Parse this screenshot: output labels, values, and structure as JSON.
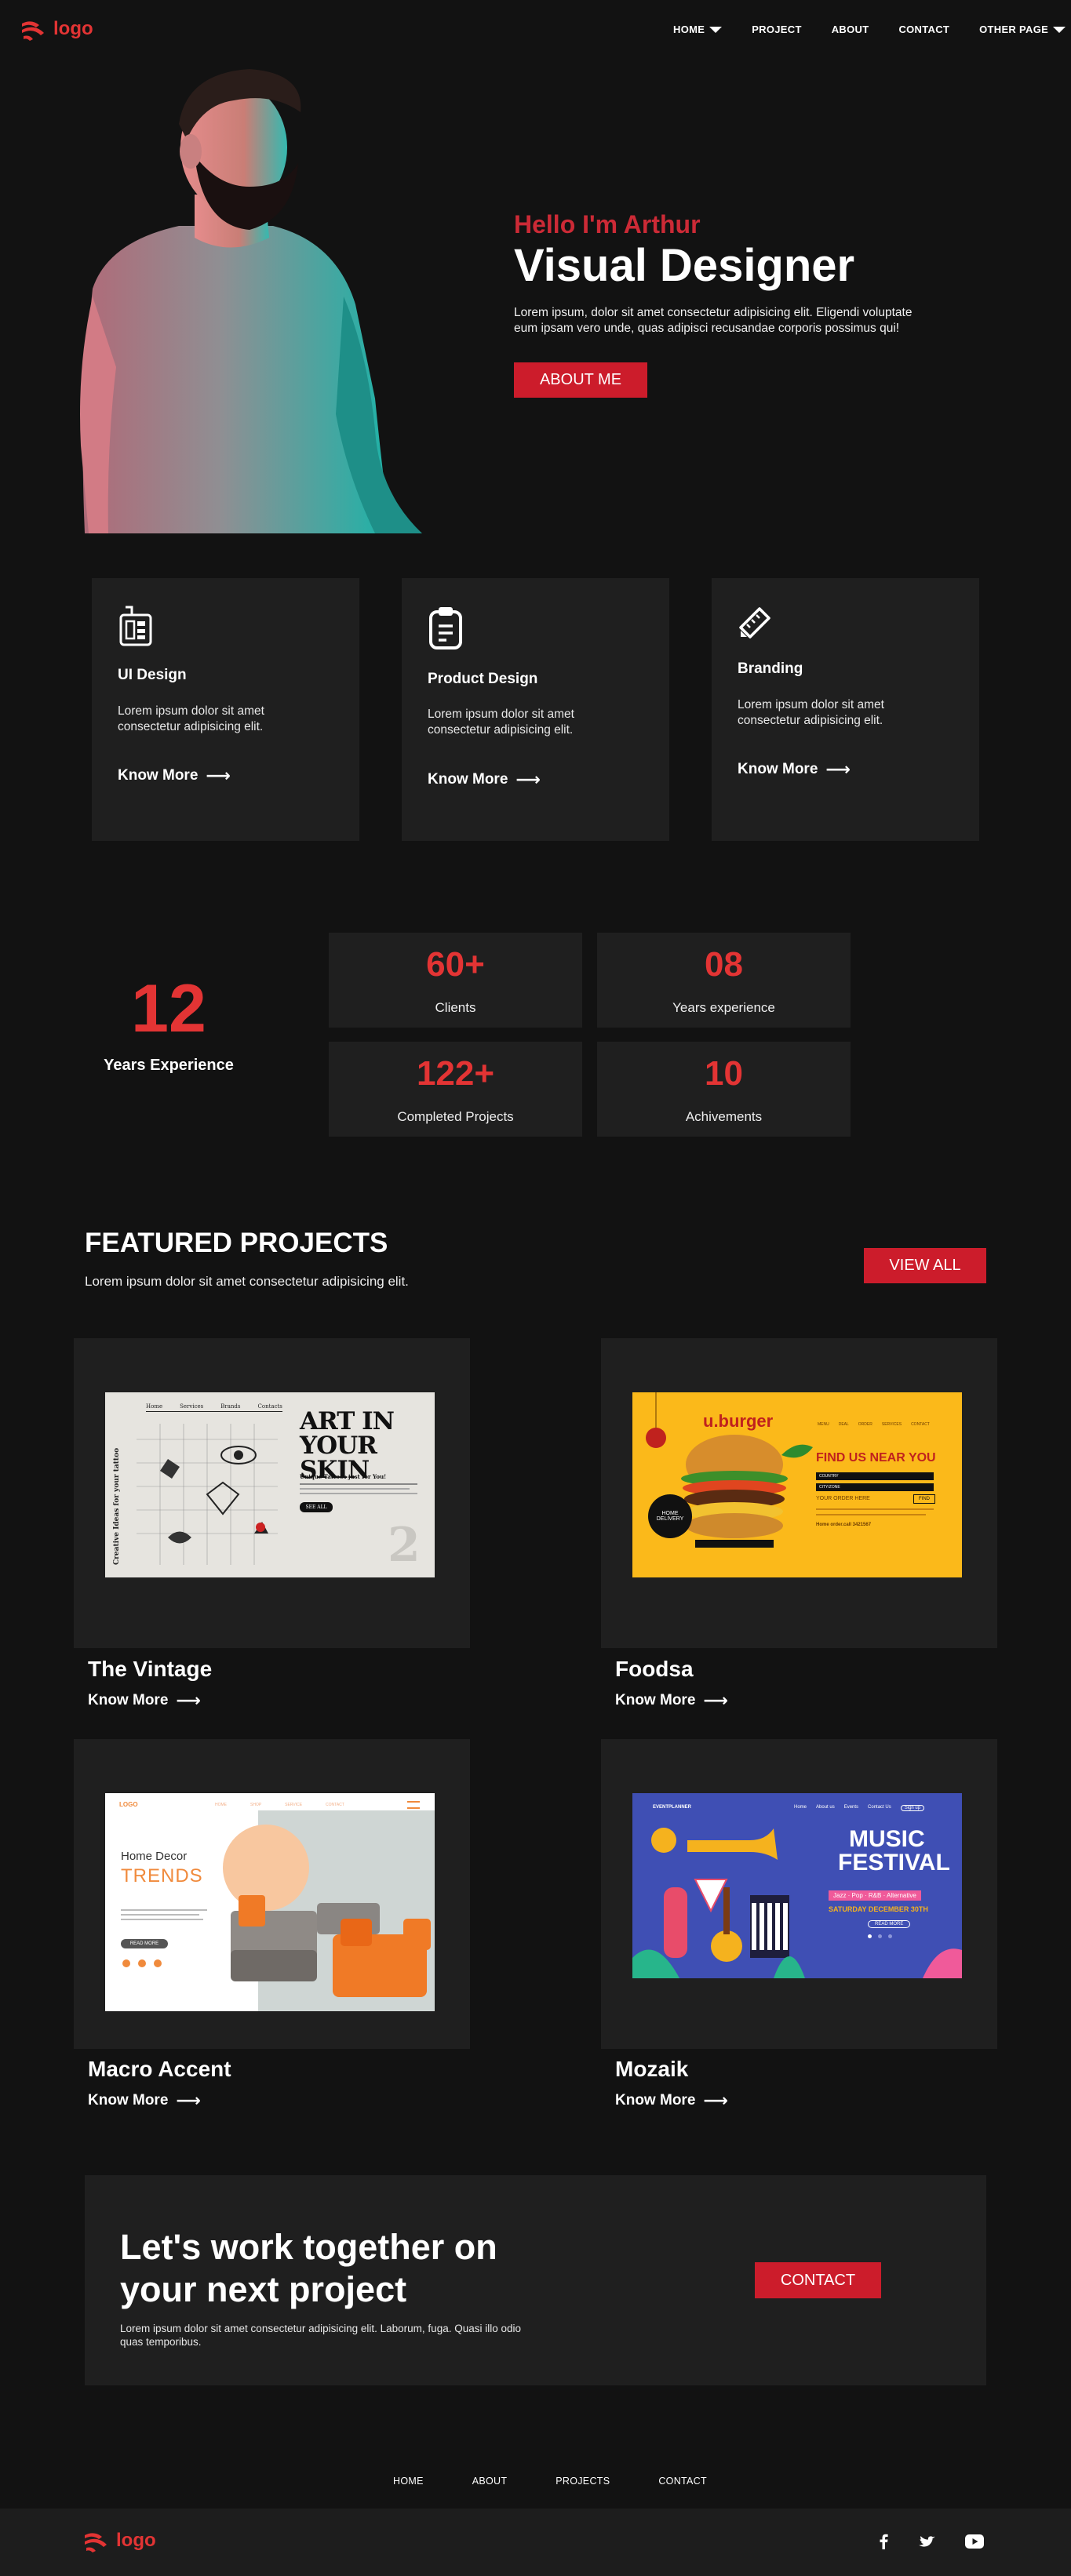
{
  "header": {
    "logo_text": "logo",
    "nav": [
      {
        "label": "HOME",
        "dropdown": true
      },
      {
        "label": "PROJECT",
        "dropdown": false
      },
      {
        "label": "ABOUT",
        "dropdown": false
      },
      {
        "label": "CONTACT",
        "dropdown": false
      },
      {
        "label": "OTHER PAGE",
        "dropdown": true
      }
    ]
  },
  "hero": {
    "greeting": "Hello I'm Arthur",
    "title": "Visual Designer",
    "description": "Lorem ipsum, dolor sit amet consectetur adipisicing elit. Eligendi voluptate eum ipsam vero unde, quas adipisci recusandae corporis possimus qui!",
    "button": "ABOUT ME"
  },
  "services": [
    {
      "icon": "calculator-icon",
      "title": "UI Design",
      "desc": "Lorem ipsum dolor sit amet consectetur adipisicing elit.",
      "link": "Know More"
    },
    {
      "icon": "clipboard-icon",
      "title": "Product Design",
      "desc": "Lorem ipsum dolor sit amet consectetur adipisicing elit.",
      "link": "Know More"
    },
    {
      "icon": "ruler-pencil-icon",
      "title": "Branding",
      "desc": "Lorem ipsum dolor sit amet consectetur adipisicing elit.",
      "link": "Know More"
    }
  ],
  "experience": {
    "number": "12",
    "label": "Years Experience",
    "stats": [
      {
        "value": "60+",
        "label": "Clients"
      },
      {
        "value": "08",
        "label": "Years experience"
      },
      {
        "value": "122+",
        "label": "Completed Projects"
      },
      {
        "value": "10",
        "label": "Achivements"
      }
    ]
  },
  "featured": {
    "title": "FEATURED PROJECTS",
    "subtitle": "Lorem ipsum dolor sit amet consectetur adipisicing elit.",
    "view_all": "VIEW ALL",
    "projects": [
      {
        "name": "The Vintage",
        "link": "Know More",
        "thumb": {
          "nav": [
            "Home",
            "Services",
            "Brands",
            "Contacts"
          ],
          "headline1": "ART IN",
          "headline2": "YOUR SKIN",
          "side": "Creative Ideas for your tattoo",
          "sub": "Unique Tattoos just for You!",
          "btn": "SEE ALL"
        }
      },
      {
        "name": "Foodsa",
        "link": "Know More",
        "thumb": {
          "brand": "u.burger",
          "nav": [
            "MENU",
            "DEAL",
            "ORDER",
            "SERVICES",
            "CONTACT"
          ],
          "headline": "FIND US NEAR YOU",
          "fields": [
            "COUNTRY",
            "CITY/ZONE"
          ],
          "order_label": "YOUR ORDER HERE",
          "find_btn": "FIND",
          "badge1": "HOME",
          "badge2": "DELIVERY",
          "footer": "Home order.call 3421567"
        }
      },
      {
        "name": "Macro Accent",
        "link": "Know More",
        "thumb": {
          "logo": "LOGO",
          "nav": [
            "HOME",
            "SHOP",
            "SERVICE",
            "CONTACT"
          ],
          "headline1": "Home Decor",
          "headline2": "TRENDS",
          "btn": "READ MORE"
        }
      },
      {
        "name": "Mozaik",
        "link": "Know More",
        "thumb": {
          "brand": "EVENTPLANNER",
          "nav": [
            "Home",
            "About us",
            "Events",
            "Contact Us"
          ],
          "nav_btn": "Sign up",
          "headline1": "MUSIC",
          "headline2": "FESTIVAL",
          "genres": "Jazz · Pop · R&B · Alternative",
          "date": "SATURDAY DECEMBER 30TH",
          "btn": "READ MORE"
        }
      }
    ]
  },
  "cta": {
    "title_line1": "Let's work together on",
    "title_line2": "your next project",
    "desc": "Lorem ipsum dolor sit amet consectetur adipisicing elit. Laborum, fuga. Quasi illo odio quas temporibus.",
    "button": "CONTACT"
  },
  "footer": {
    "nav": [
      "HOME",
      "ABOUT",
      "PROJECTS",
      "CONTACT"
    ],
    "logo_text": "logo",
    "social": [
      "facebook-icon",
      "twitter-icon",
      "youtube-icon"
    ]
  },
  "colors": {
    "background": "#121212",
    "card": "#1f1f1f",
    "accent_red": "#cc1c2b",
    "number_red": "#e33434"
  }
}
